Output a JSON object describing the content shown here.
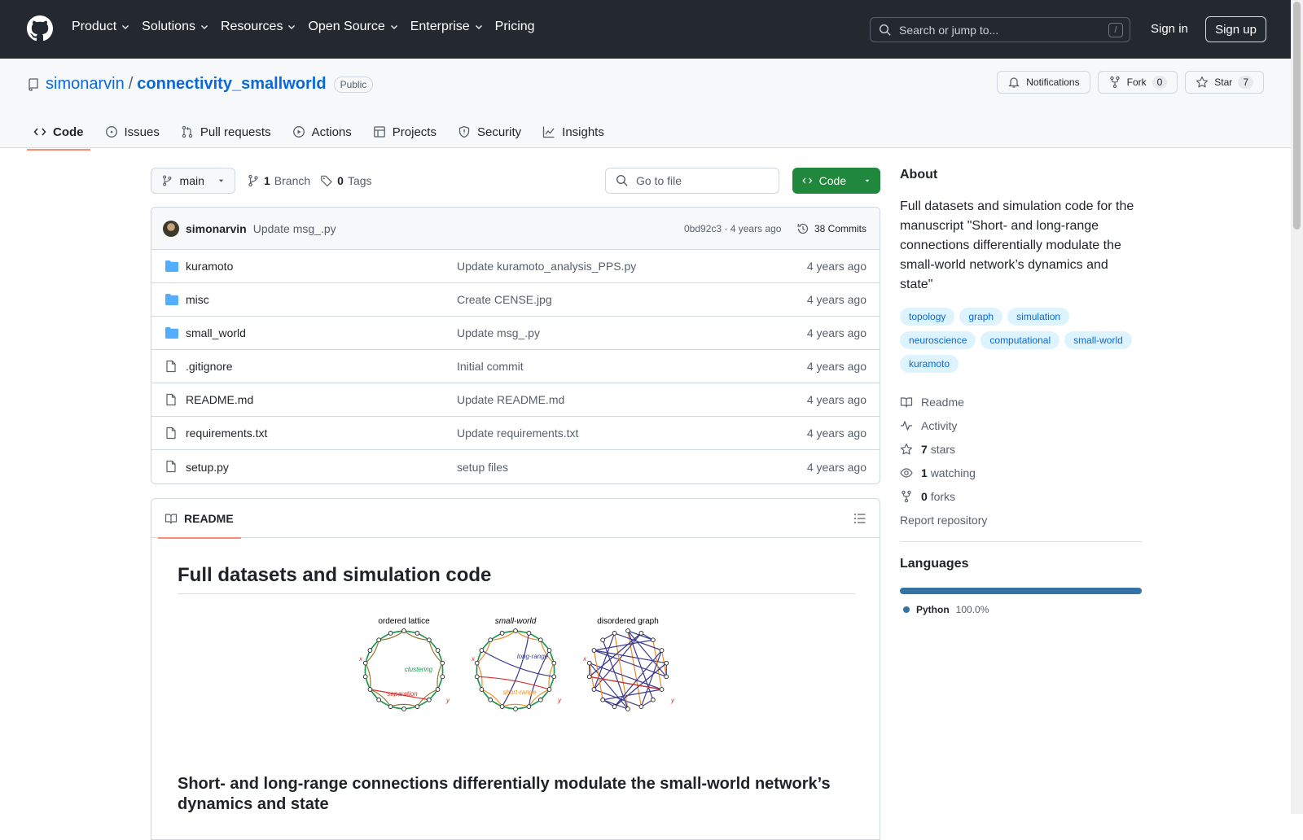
{
  "topbar": {
    "nav": [
      {
        "label": "Product",
        "has_menu": true
      },
      {
        "label": "Solutions",
        "has_menu": true
      },
      {
        "label": "Resources",
        "has_menu": true
      },
      {
        "label": "Open Source",
        "has_menu": true
      },
      {
        "label": "Enterprise",
        "has_menu": true
      },
      {
        "label": "Pricing",
        "has_menu": false
      }
    ],
    "search_placeholder": "Search or jump to...",
    "search_shortcut": "/",
    "signin": "Sign in",
    "signup": "Sign up"
  },
  "repo": {
    "owner": "simonarvin",
    "separator": "/",
    "name": "connectivity_smallworld",
    "visibility": "Public",
    "notifications_label": "Notifications",
    "fork_label": "Fork",
    "fork_count": "0",
    "star_label": "Star",
    "star_count": "7"
  },
  "tabs": [
    {
      "label": "Code",
      "icon": "code-icon",
      "active": true
    },
    {
      "label": "Issues",
      "icon": "issue-icon",
      "active": false
    },
    {
      "label": "Pull requests",
      "icon": "pull-request-icon",
      "active": false
    },
    {
      "label": "Actions",
      "icon": "play-icon",
      "active": false
    },
    {
      "label": "Projects",
      "icon": "table-icon",
      "active": false
    },
    {
      "label": "Security",
      "icon": "shield-icon",
      "active": false
    },
    {
      "label": "Insights",
      "icon": "graph-icon",
      "active": false
    }
  ],
  "toolbar": {
    "branch": "main",
    "branch_count": "1",
    "branch_label": "Branch",
    "tag_count": "0",
    "tag_label": "Tags",
    "goto_placeholder": "Go to file",
    "code_button": "Code"
  },
  "commit": {
    "author": "simonarvin",
    "message": "Update msg_.py",
    "sha_time": "0bd92c3 · 4 years ago",
    "commits": "38 Commits"
  },
  "files": [
    {
      "name": "kuramoto",
      "type": "dir",
      "message": "Update kuramoto_analysis_PPS.py",
      "date": "4 years ago"
    },
    {
      "name": "misc",
      "type": "dir",
      "message": "Create CENSE.jpg",
      "date": "4 years ago"
    },
    {
      "name": "small_world",
      "type": "dir",
      "message": "Update msg_.py",
      "date": "4 years ago"
    },
    {
      "name": ".gitignore",
      "type": "file",
      "message": "Initial commit",
      "date": "4 years ago"
    },
    {
      "name": "README.md",
      "type": "file",
      "message": "Update README.md",
      "date": "4 years ago"
    },
    {
      "name": "requirements.txt",
      "type": "file",
      "message": "Update requirements.txt",
      "date": "4 years ago"
    },
    {
      "name": "setup.py",
      "type": "file",
      "message": "setup files",
      "date": "4 years ago"
    }
  ],
  "readme": {
    "tab_label": "README",
    "h1": "Full datasets and simulation code",
    "figure": {
      "panels": [
        "ordered lattice",
        "small-world",
        "disordered graph"
      ],
      "labels": {
        "clustering": "clustering",
        "separation": "separation",
        "long_range": "long-range",
        "short_range": "short-range",
        "x": "x",
        "y": "y"
      }
    },
    "h2": "Short- and long-range connections differentially modulate the small-world network’s dynamics and state"
  },
  "about": {
    "title": "About",
    "description": "Full datasets and simulation code for the manuscript \"Short- and long-range connections differentially modulate the small-world network’s dynamics and state\"",
    "topics": [
      "topology",
      "graph",
      "simulation",
      "neuroscience",
      "computational",
      "small-world",
      "kuramoto"
    ],
    "links": [
      {
        "icon": "book-icon",
        "bold": "",
        "label": "Readme"
      },
      {
        "icon": "pulse-icon",
        "bold": "",
        "label": "Activity"
      },
      {
        "icon": "star-icon",
        "bold": "7",
        "label": "stars"
      },
      {
        "icon": "eye-icon",
        "bold": "1",
        "label": "watching"
      },
      {
        "icon": "fork-icon",
        "bold": "0",
        "label": "forks"
      }
    ],
    "report": "Report repository"
  },
  "languages": {
    "title": "Languages",
    "items": [
      {
        "name": "Python",
        "percent": "100.0%",
        "color": "#3572a5"
      }
    ]
  }
}
